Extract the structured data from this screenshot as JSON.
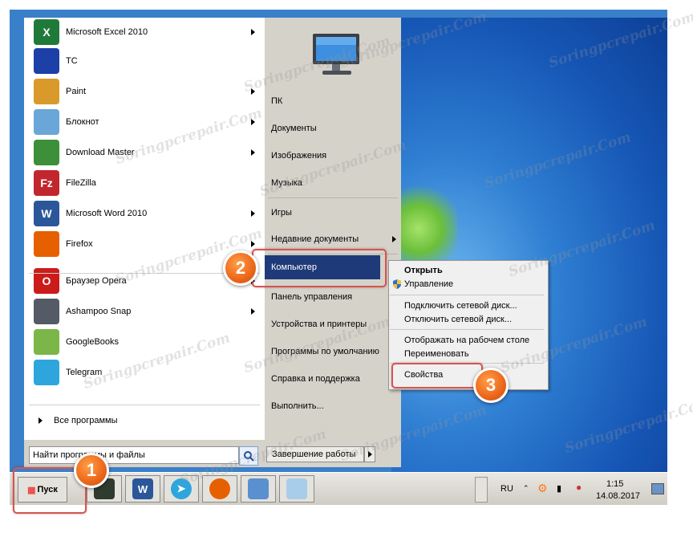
{
  "left_items": [
    {
      "label": "Microsoft Excel 2010",
      "icon": "excel-icon",
      "color": "#1f7a3a",
      "glyph": "X",
      "arrow": true
    },
    {
      "label": "TC",
      "icon": "total-commander-icon",
      "color": "#1c3fa8",
      "glyph": "",
      "arrow": false
    },
    {
      "label": "Paint",
      "icon": "paint-icon",
      "color": "#d99a2b",
      "glyph": "",
      "arrow": true
    },
    {
      "label": "Блокнот",
      "icon": "notepad-icon",
      "color": "#6aa7d8",
      "glyph": "",
      "arrow": true
    },
    {
      "label": "Download Master",
      "icon": "download-master-icon",
      "color": "#3d8f3a",
      "glyph": "",
      "arrow": true
    },
    {
      "label": "FileZilla",
      "icon": "filezilla-icon",
      "color": "#c1272d",
      "glyph": "Fz",
      "arrow": false
    },
    {
      "label": "Microsoft Word 2010",
      "icon": "word-icon",
      "color": "#2b579a",
      "glyph": "W",
      "arrow": true
    },
    {
      "label": "Firefox",
      "icon": "firefox-icon",
      "color": "#e66000",
      "glyph": "",
      "arrow": true
    },
    {
      "label": "Браузер Opera",
      "icon": "opera-icon",
      "color": "#cc1b1b",
      "glyph": "O",
      "arrow": true
    },
    {
      "label": "Ashampoo Snap",
      "icon": "ashampoo-snap-icon",
      "color": "#555b66",
      "glyph": "",
      "arrow": true
    },
    {
      "label": "GoogleBooks",
      "icon": "googlebooks-icon",
      "color": "#7ab648",
      "glyph": "",
      "arrow": false
    },
    {
      "label": "Telegram",
      "icon": "telegram-icon",
      "color": "#2ea6dd",
      "glyph": "",
      "arrow": false
    }
  ],
  "all_programs": "Все программы",
  "search_placeholder": "Найти программы и файлы",
  "right_items": [
    {
      "label": "ПК",
      "arrow": false
    },
    {
      "label": "Документы",
      "arrow": false
    },
    {
      "label": "Изображения",
      "arrow": false
    },
    {
      "label": "Музыка",
      "arrow": false
    },
    {
      "label": "Игры",
      "arrow": false
    },
    {
      "label": "Недавние документы",
      "arrow": true
    },
    {
      "label": "Компьютер",
      "arrow": false
    },
    {
      "label": "Панель управления",
      "arrow": false
    },
    {
      "label": "Устройства и принтеры",
      "arrow": false
    },
    {
      "label": "Программы по умолчанию",
      "arrow": false
    },
    {
      "label": "Справка и поддержка",
      "arrow": false
    },
    {
      "label": "Выполнить...",
      "arrow": false
    }
  ],
  "shutdown_label": "Завершение работы",
  "context_menu": {
    "open": "Открыть",
    "manage": "Управление",
    "map_drive": "Подключить сетевой диск...",
    "disconnect_drive": "Отключить сетевой диск...",
    "show_desktop": "Отображать на рабочем столе",
    "rename": "Переименовать",
    "properties": "Свойства"
  },
  "start_label": "Пуск",
  "tray": {
    "lang": "RU",
    "time": "1:15",
    "date": "14.08.2017"
  },
  "badges": [
    "1",
    "2",
    "3"
  ],
  "watermark": "Soringpcrepair.Com"
}
